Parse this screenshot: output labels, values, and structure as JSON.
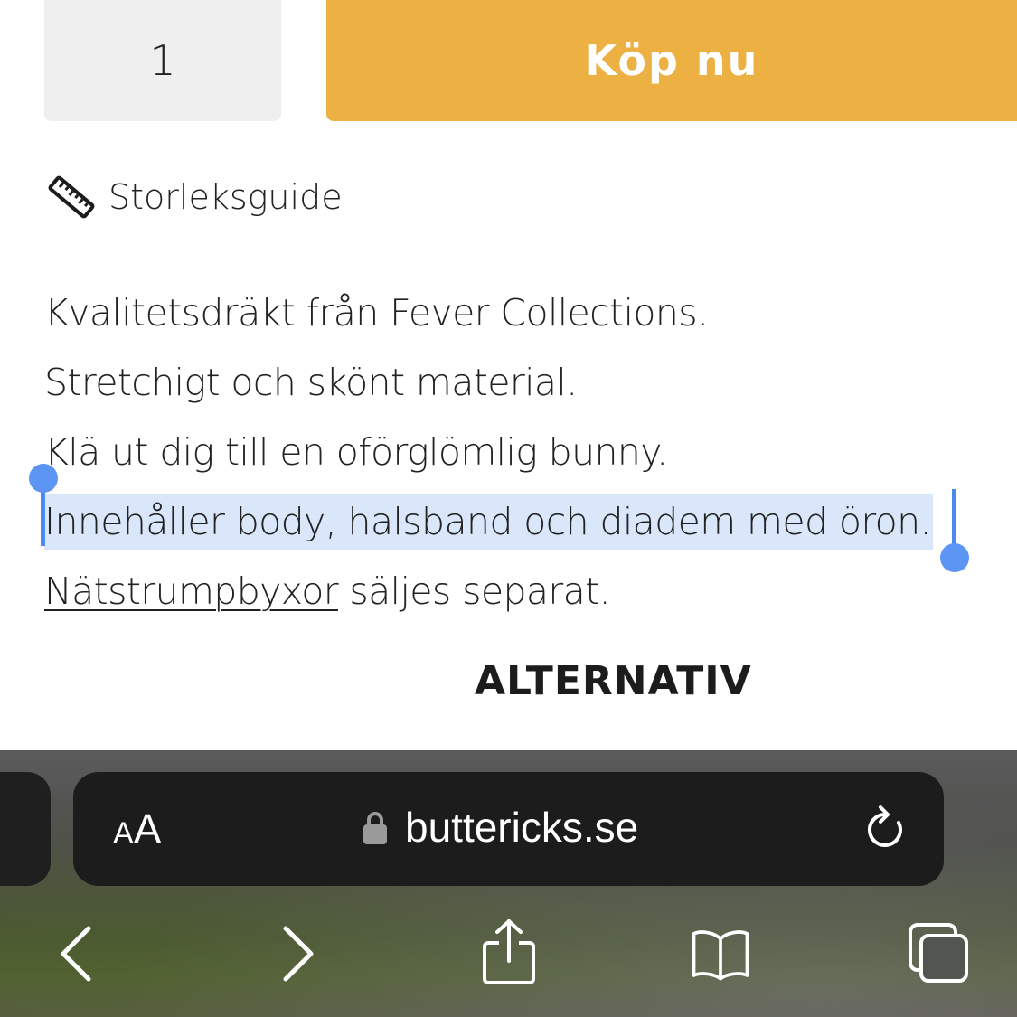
{
  "purchase": {
    "quantity": "1",
    "buy_label": "Köp nu",
    "buy_color": "#ecb142"
  },
  "size_guide": {
    "icon": "ruler-icon",
    "label": "Storleksguide"
  },
  "description": {
    "line1": "Kvalitetsdräkt från Fever Collections.",
    "line2": "Stretchigt och skönt material.",
    "line3": "Klä ut dig till en oförglömlig bunny.",
    "line4_selected": "Innehåller body, halsband och diadem med öron.",
    "line5_link": "Nätstrumpbyxor",
    "line5_rest": " säljes separat."
  },
  "section_heading": "ALTERNATIV",
  "browser": {
    "text_size_button_small": "A",
    "text_size_button_big": "A",
    "lock_icon": "lock-icon",
    "url": "buttericks.se",
    "reload_icon": "reload-icon",
    "toolbar_icons": [
      "back-icon",
      "forward-icon",
      "share-icon",
      "bookmarks-icon",
      "tabs-icon"
    ],
    "selection_color": "#dae7fb",
    "handle_color": "#5c95f3"
  }
}
